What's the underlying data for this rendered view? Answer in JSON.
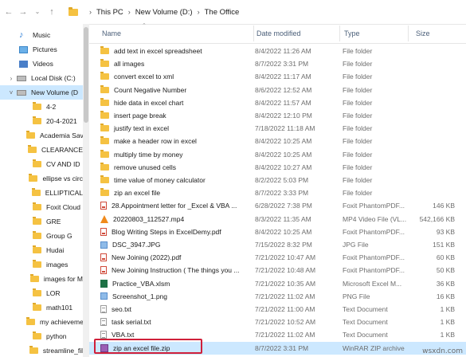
{
  "address_bar": {
    "back_icon": "arrow-left-icon",
    "forward_icon": "arrow-right-icon",
    "recent_icon": "chevron-down-icon",
    "up_icon": "arrow-up-icon",
    "crumbs": [
      "This PC",
      "New Volume (D:)",
      "The Office"
    ]
  },
  "sidebar": {
    "items": [
      {
        "label": "Music",
        "icon": "music-icon"
      },
      {
        "label": "Pictures",
        "icon": "pictures-icon"
      },
      {
        "label": "Videos",
        "icon": "videos-icon"
      },
      {
        "label": "Local Disk (C:)",
        "icon": "drive-icon"
      },
      {
        "label": "New Volume (D",
        "icon": "drive-icon"
      },
      {
        "label": "4-2",
        "icon": "folder-icon"
      },
      {
        "label": "20-4-2021",
        "icon": "folder-icon"
      },
      {
        "label": "Academia Sav",
        "icon": "folder-icon"
      },
      {
        "label": "CLEARANCE",
        "icon": "folder-icon"
      },
      {
        "label": "CV AND ID",
        "icon": "folder-icon"
      },
      {
        "label": "ellipse vs circ",
        "icon": "folder-icon"
      },
      {
        "label": "ELLIPTICAL",
        "icon": "folder-icon"
      },
      {
        "label": "Foxit Cloud",
        "icon": "folder-icon"
      },
      {
        "label": "GRE",
        "icon": "folder-icon"
      },
      {
        "label": "Group G",
        "icon": "folder-icon"
      },
      {
        "label": "Hudai",
        "icon": "folder-icon"
      },
      {
        "label": "images",
        "icon": "folder-icon"
      },
      {
        "label": "images for M",
        "icon": "folder-icon"
      },
      {
        "label": "LOR",
        "icon": "folder-icon"
      },
      {
        "label": "math101",
        "icon": "folder-icon"
      },
      {
        "label": "my achieveme",
        "icon": "folder-icon"
      },
      {
        "label": "python",
        "icon": "folder-icon"
      },
      {
        "label": "streamline_fil",
        "icon": "folder-icon"
      }
    ]
  },
  "columns": {
    "name": "Name",
    "date": "Date modified",
    "type": "Type",
    "size": "Size"
  },
  "files": [
    {
      "name": "add text in excel spreadsheet",
      "date": "8/4/2022 11:26 AM",
      "type": "File folder",
      "size": "",
      "icon": "folder"
    },
    {
      "name": "all images",
      "date": "8/7/2022 3:31 PM",
      "type": "File folder",
      "size": "",
      "icon": "folder"
    },
    {
      "name": "convert excel to xml",
      "date": "8/4/2022 11:17 AM",
      "type": "File folder",
      "size": "",
      "icon": "folder"
    },
    {
      "name": "Count Negative Number",
      "date": "8/6/2022 12:52 AM",
      "type": "File folder",
      "size": "",
      "icon": "folder"
    },
    {
      "name": "hide data in excel chart",
      "date": "8/4/2022 11:57 AM",
      "type": "File folder",
      "size": "",
      "icon": "folder"
    },
    {
      "name": "insert page break",
      "date": "8/4/2022 12:10 PM",
      "type": "File folder",
      "size": "",
      "icon": "folder"
    },
    {
      "name": "justify text in excel",
      "date": "7/18/2022 11:18 AM",
      "type": "File folder",
      "size": "",
      "icon": "folder"
    },
    {
      "name": "make a header row in excel",
      "date": "8/4/2022 10:25 AM",
      "type": "File folder",
      "size": "",
      "icon": "folder"
    },
    {
      "name": "multiply time by money",
      "date": "8/4/2022 10:25 AM",
      "type": "File folder",
      "size": "",
      "icon": "folder"
    },
    {
      "name": "remove unused cells",
      "date": "8/4/2022 10:27 AM",
      "type": "File folder",
      "size": "",
      "icon": "folder"
    },
    {
      "name": "time value of money calculator",
      "date": "8/2/2022 5:03 PM",
      "type": "File folder",
      "size": "",
      "icon": "folder"
    },
    {
      "name": "zip an excel file",
      "date": "8/7/2022 3:33 PM",
      "type": "File folder",
      "size": "",
      "icon": "folder"
    },
    {
      "name": "28.Appointment letter for _Excel & VBA ...",
      "date": "6/28/2022 7:38 PM",
      "type": "Foxit PhantomPDF...",
      "size": "146 KB",
      "icon": "pdf"
    },
    {
      "name": "20220803_112527.mp4",
      "date": "8/3/2022 11:35 AM",
      "type": "MP4 Video File (VL...",
      "size": "542,166 KB",
      "icon": "vlc"
    },
    {
      "name": "Blog Writing Steps in ExcelDemy.pdf",
      "date": "8/4/2022 10:25 AM",
      "type": "Foxit PhantomPDF...",
      "size": "93 KB",
      "icon": "pdf"
    },
    {
      "name": "DSC_3947.JPG",
      "date": "7/15/2022 8:32 PM",
      "type": "JPG File",
      "size": "151 KB",
      "icon": "img"
    },
    {
      "name": "New Joining (2022).pdf",
      "date": "7/21/2022 10:47 AM",
      "type": "Foxit PhantomPDF...",
      "size": "60 KB",
      "icon": "pdf"
    },
    {
      "name": "New Joining Instruction ( The things you ...",
      "date": "7/21/2022 10:48 AM",
      "type": "Foxit PhantomPDF...",
      "size": "50 KB",
      "icon": "pdf"
    },
    {
      "name": "Practice_VBA.xlsm",
      "date": "7/21/2022 10:35 AM",
      "type": "Microsoft Excel M...",
      "size": "36 KB",
      "icon": "xls"
    },
    {
      "name": "Screenshot_1.png",
      "date": "7/21/2022 11:02 AM",
      "type": "PNG File",
      "size": "16 KB",
      "icon": "img"
    },
    {
      "name": "seo.txt",
      "date": "7/21/2022 11:00 AM",
      "type": "Text Document",
      "size": "1 KB",
      "icon": "txt"
    },
    {
      "name": "task serial.txt",
      "date": "7/21/2022 10:52 AM",
      "type": "Text Document",
      "size": "1 KB",
      "icon": "txt"
    },
    {
      "name": "VBA.txt",
      "date": "7/21/2022 11:02 AM",
      "type": "Text Document",
      "size": "1 KB",
      "icon": "txt"
    },
    {
      "name": "zip an excel file.zip",
      "date": "8/7/2022 3:31 PM",
      "type": "WinRAR ZIP archive",
      "size": "",
      "icon": "zip"
    }
  ],
  "watermark": "wsxdn.com",
  "colors": {
    "selection": "#cce8ff",
    "highlight_box": "#d0203a",
    "folder": "#f5c242"
  }
}
